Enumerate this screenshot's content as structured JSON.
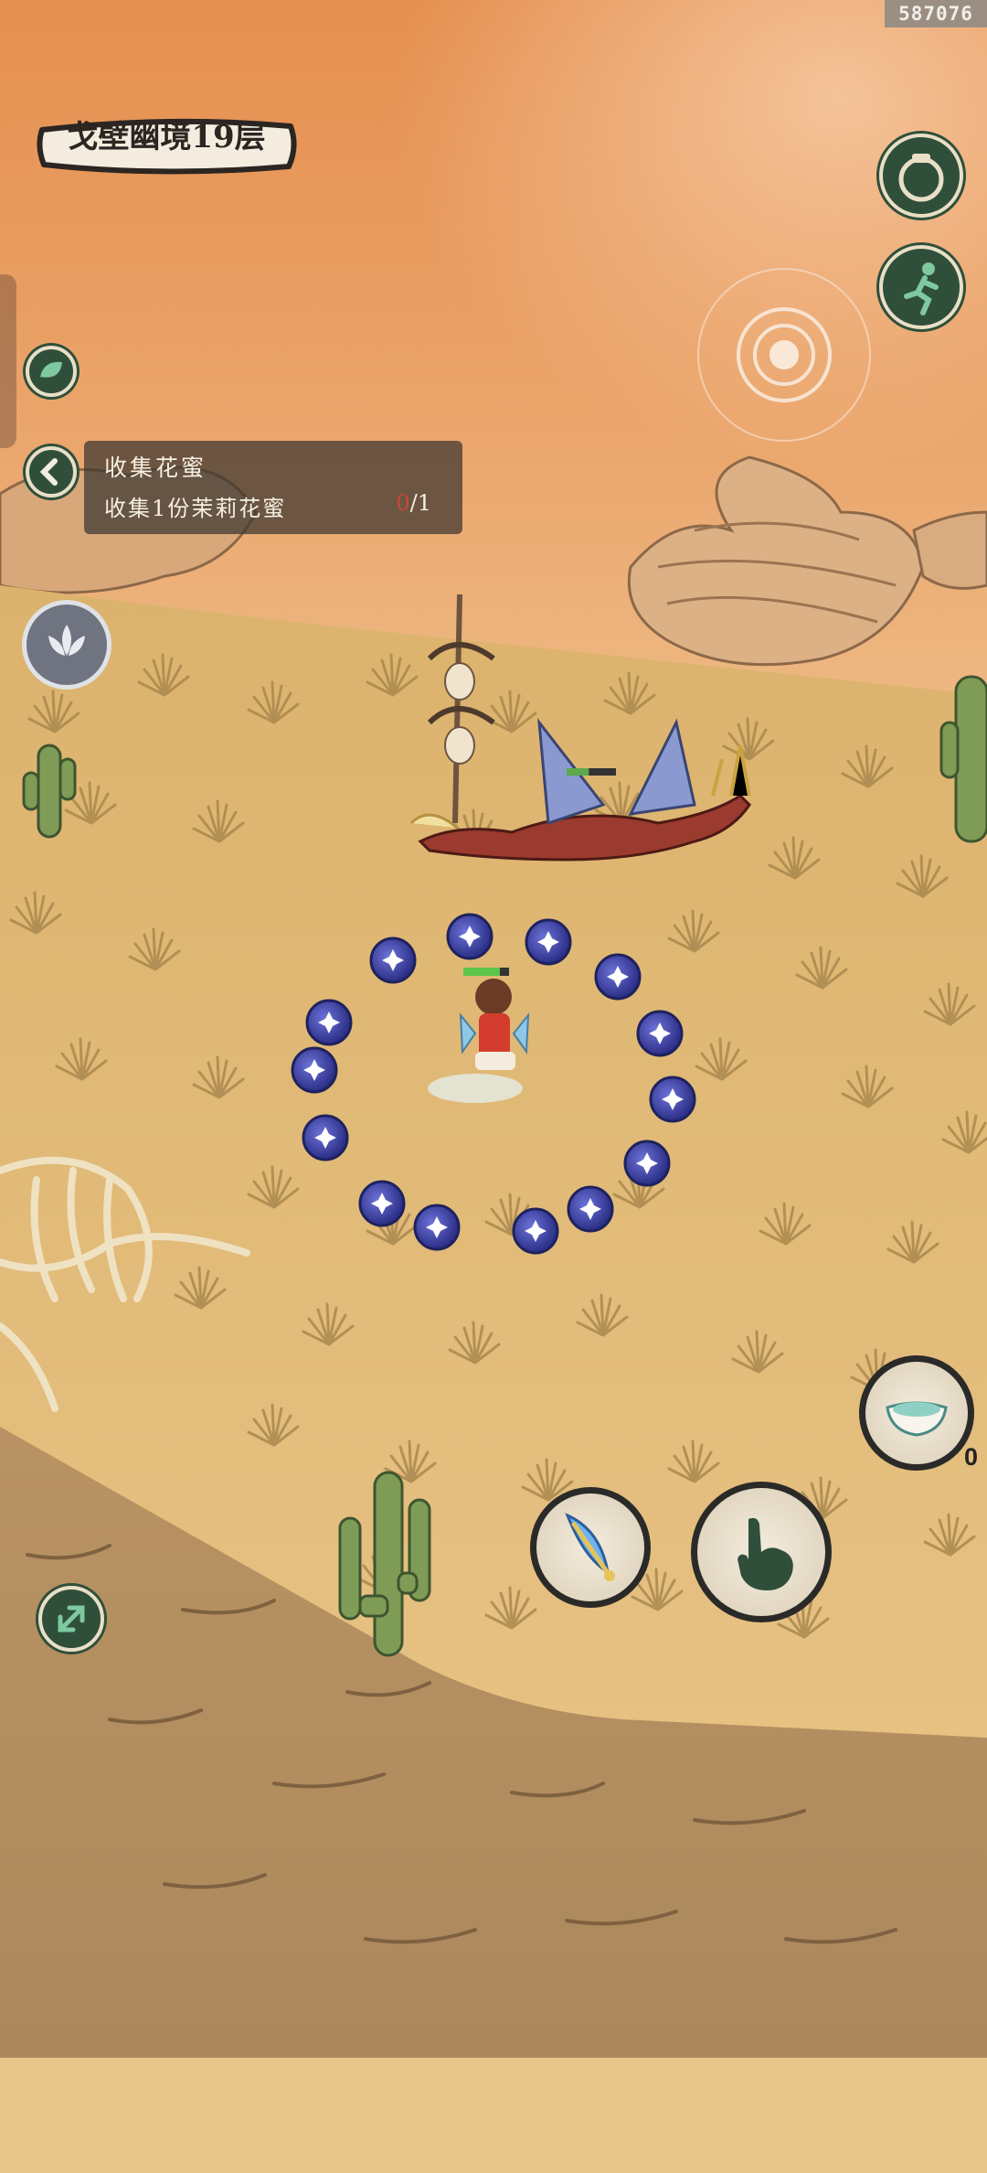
{
  "build_id": "587076",
  "level": {
    "title": "戈壁幽境19层"
  },
  "quest": {
    "title": "收集花蜜",
    "description": "收集1份茉莉花蜜",
    "progress_current": "0",
    "progress_total": "/1"
  },
  "inventory": {
    "bowl_count": "0"
  },
  "player": {
    "health_fraction": 0.8
  },
  "enemy": {
    "health_fraction": 0.45
  },
  "icons": {
    "jar": "jar-icon",
    "sprint": "running-figure-icon",
    "leaf": "leaf-icon",
    "back": "chevron-left-icon",
    "lotus": "lotus-icon",
    "bowl": "bowl-icon",
    "feather": "feather-icon",
    "hand": "pointing-hand-icon",
    "expand": "expand-arrows-icon"
  },
  "colors": {
    "hud_green": "#2f4f3b",
    "orb_blue": "#3a3fa0",
    "sand": "#d9b26f",
    "sky": "#e7a565"
  }
}
